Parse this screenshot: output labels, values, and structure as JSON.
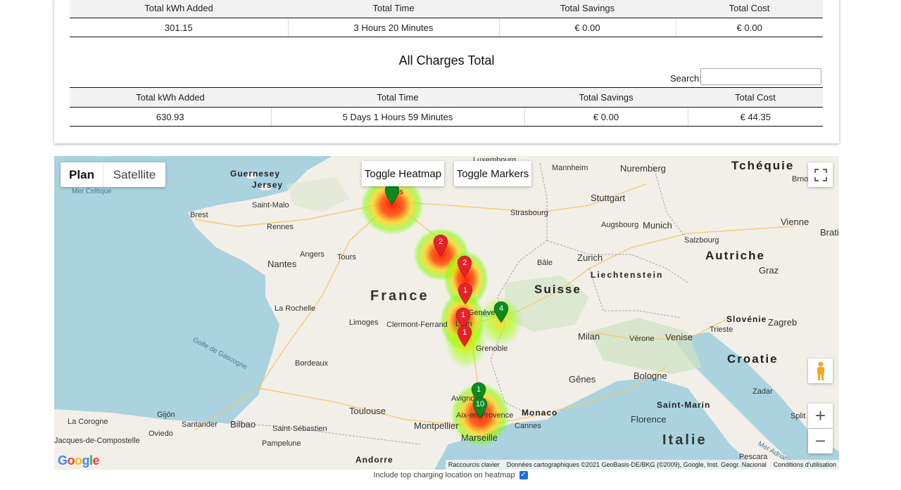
{
  "table1": {
    "headers": [
      "Total kWh Added",
      "Total Time",
      "Total Savings",
      "Total Cost"
    ],
    "row": [
      "301.15",
      "3 Hours 20 Minutes",
      "€ 0.00",
      "€ 0.00"
    ]
  },
  "all_total": {
    "title": "All Charges Total",
    "search_label": "Search:",
    "search_value": "",
    "headers": [
      "Total kWh Added",
      "Total Time",
      "Total Savings",
      "Total Cost"
    ],
    "row": [
      "630.93",
      "5 Days 1 Hours 59 Minutes",
      "€ 0.00",
      "€ 44.35"
    ]
  },
  "map": {
    "map_type": {
      "plan": "Plan",
      "satellite": "Satellite",
      "selected": "Plan"
    },
    "toggle_heatmap": "Toggle Heatmap",
    "toggle_markers": "Toggle Markers",
    "zoom_in": "+",
    "zoom_out": "−",
    "logo": "Google",
    "attribution": {
      "shortcuts": "Raccourcis clavier",
      "data": "Données cartographiques ©2021 GeoBasis-DE/BKG (©2009), Google, Inst. Geogr. Nacional",
      "terms": "Conditions d'utilisation"
    },
    "labels": {
      "france": "France",
      "suisse": "Suisse",
      "italie": "Italie",
      "autriche": "Autriche",
      "tcheque": "Tchéquie",
      "croatie": "Croatie",
      "slovenie": "Slovénie",
      "liechtenstein": "Liechtenstein",
      "monaco": "Monaco",
      "andorre": "Andorre",
      "guernesey": "Guernesey",
      "jersey": "Jersey",
      "saint_marin": "Saint-Marin",
      "luxembourg": "Luxembourg",
      "mer_celtique": "Mer Celtique",
      "golfe": "Golfe de Gascogne",
      "mer_adriatique": "Mer Adriatique",
      "brest": "Brest",
      "rennes": "Rennes",
      "nantes": "Nantes",
      "angers": "Angers",
      "tours": "Tours",
      "saint_malo": "Saint-Malo",
      "paris": "Paris",
      "strasbourg": "Strasbourg",
      "stuttgart": "Stuttgart",
      "mannheim": "Mannheim",
      "nuremberg": "Nuremberg",
      "augsbourg": "Augsbourg",
      "munich": "Munich",
      "salzbourg": "Salzbourg",
      "vienne": "Vienne",
      "bratislava": "Brati",
      "brno": "Brno",
      "graz": "Graz",
      "zurich": "Zurich",
      "bale": "Bâle",
      "geneve": "Genève",
      "lyon": "Lyon",
      "grenoble": "Grenoble",
      "la_rochelle": "La Rochelle",
      "limoges": "Limoges",
      "clermont": "Clermont-Ferrand",
      "bordeaux": "Bordeaux",
      "toulouse": "Toulouse",
      "montpellier": "Montpellier",
      "marseille": "Marseille",
      "avignon": "Avignon",
      "aix": "Aix-en-Provence",
      "cannes": "Cannes",
      "genes": "Gênes",
      "milan": "Milan",
      "verone": "Vérone",
      "venise": "Venise",
      "trieste": "Trieste",
      "zagreb": "Zagreb",
      "bologne": "Bologne",
      "florence": "Florence",
      "split": "Split",
      "zadar": "Zadar",
      "pescara": "Pescara",
      "bilbao": "Bilbao",
      "gijon": "Gijón",
      "oviedo": "Oviedo",
      "santander": "Santander",
      "la_corogne": "La Corogne",
      "saint_jacques": "Jacques-de-Compostelle",
      "saint_sebastien": "Saint-Sébastien",
      "pampelune": "Pampelune"
    },
    "markers": [
      {
        "label": "2",
        "status": "red"
      },
      {
        "label": "2",
        "status": "red"
      },
      {
        "label": "1",
        "status": "red"
      },
      {
        "label": "1",
        "status": "red"
      },
      {
        "label": "1",
        "status": "red"
      },
      {
        "label": "4",
        "status": "green"
      },
      {
        "label": "1",
        "status": "green"
      },
      {
        "label": "10",
        "status": "green"
      },
      {
        "label": "",
        "status": "green"
      }
    ],
    "colors": {
      "red_marker": "#e8202a",
      "green_marker": "#0b8a1e",
      "water": "#aad3df",
      "land": "#f2efe9"
    }
  },
  "footer": {
    "checkbox_label": "Include top charging location on heatmap",
    "checked": true
  }
}
